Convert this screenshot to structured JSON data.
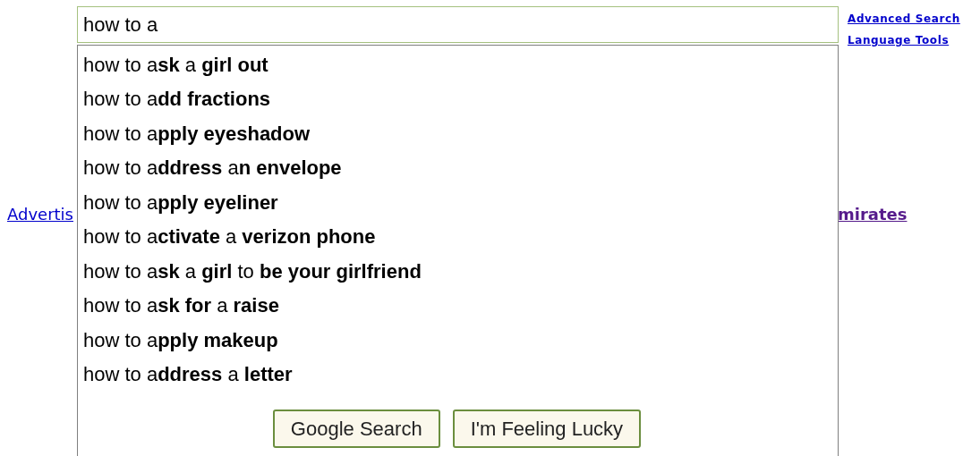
{
  "search": {
    "value": "how to a"
  },
  "suggestions": [
    "how to a**sk** a **girl out**",
    "how to a**dd fractions**",
    "how to a**pply eyeshadow**",
    "how to a**ddress** a**n envelope**",
    "how to a**pply eyeliner**",
    "how to a**ctivate** a **verizon phone**",
    "how to a**sk** a **girl** to **be your girlfriend**",
    "how to a**sk for** a **raise**",
    "how to a**pply makeup**",
    "how to a**ddress** a **letter**"
  ],
  "buttons": [
    "Google Search",
    "I'm Feeling Lucky"
  ],
  "side_links": [
    "Advanced Search",
    "Language Tools"
  ],
  "background_links": [
    {
      "text": "Advertis",
      "visited": false
    },
    {
      "text": "mirates",
      "visited": true
    }
  ]
}
